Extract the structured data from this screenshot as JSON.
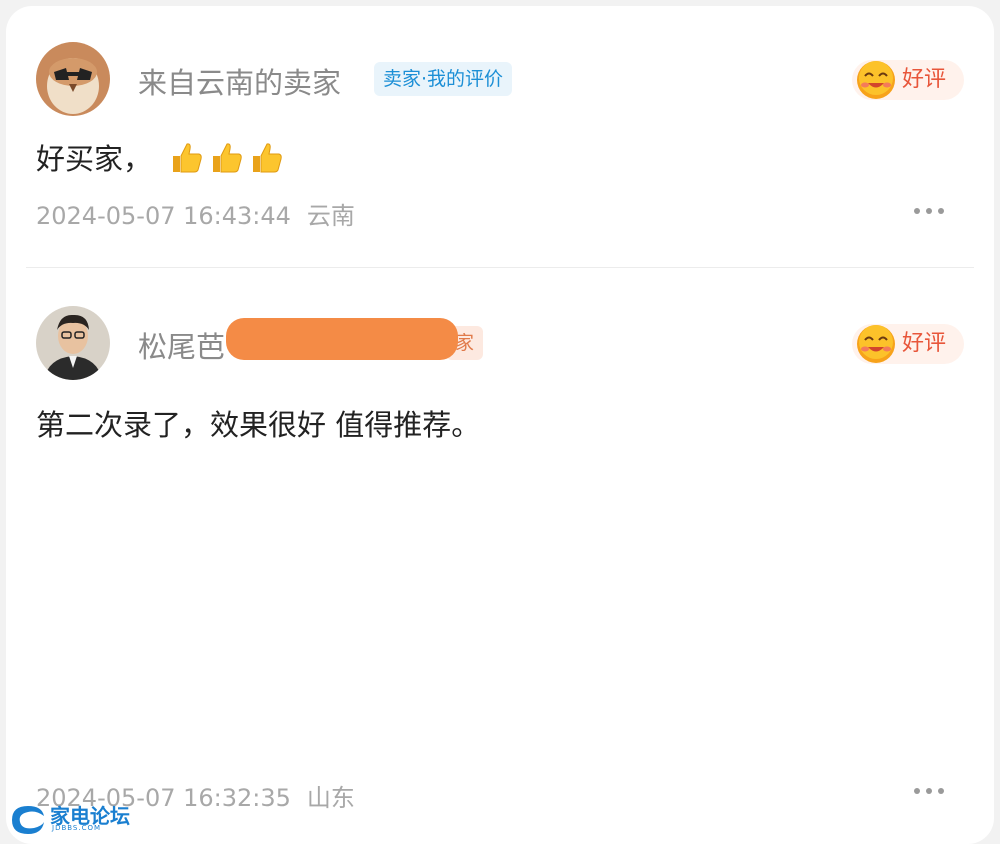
{
  "reviews": [
    {
      "username": "来自云南的卖家",
      "tag": "卖家·我的评价",
      "rating_label": "好评",
      "content": "好买家，",
      "thumbs_count": 3,
      "date": "2024-05-07 16:43:44",
      "location": "云南"
    },
    {
      "username_visible": "松尾芭",
      "tag_visible_fragment": "家",
      "rating_label": "好评",
      "content": "第二次录了，效果很好 值得推荐。",
      "date": "2024-05-07 16:32:35",
      "location": "山东"
    }
  ],
  "watermark": {
    "text": "家电论坛",
    "sub": "JDBBS.COM"
  },
  "colors": {
    "tag_bg": "#e9f4fb",
    "tag_text": "#1c8fd6",
    "rating_text": "#e8563a",
    "redaction": "#f48b46"
  }
}
